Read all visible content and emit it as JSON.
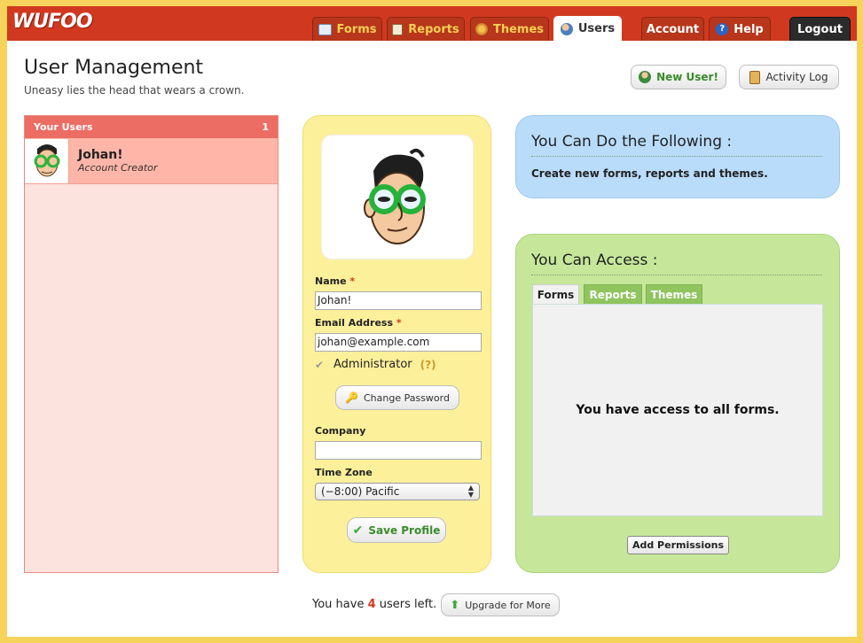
{
  "brand": {
    "logo": "WUFOO",
    "accent": "#d0391f",
    "tab_text_color": "#f6cf53"
  },
  "nav": {
    "tabs": [
      {
        "label": "Forms",
        "icon": "forms-icon"
      },
      {
        "label": "Reports",
        "icon": "reports-icon"
      },
      {
        "label": "Themes",
        "icon": "themes-icon"
      },
      {
        "label": "Users",
        "icon": "users-icon",
        "active": true
      }
    ],
    "account": "Account",
    "help": "Help",
    "logout": "Logout"
  },
  "header": {
    "title": "User Management",
    "subtitle": "Uneasy lies the head that wears a crown.",
    "new_user_label": "New User!",
    "activity_log_label": "Activity Log"
  },
  "users": {
    "heading": "Your Users",
    "count": "1",
    "items": [
      {
        "name": "Johan!",
        "role": "Account Creator"
      }
    ]
  },
  "profile": {
    "name_label": "Name",
    "name_value": "Johan!",
    "email_label": "Email Address",
    "email_value": "johan@example.com",
    "required_mark": "*",
    "admin_label": "Administrator",
    "admin_help": "(?)",
    "admin_checked": true,
    "change_password_label": "Change Password",
    "company_label": "Company",
    "company_value": "",
    "timezone_label": "Time Zone",
    "timezone_value": "(−8:00) Pacific",
    "save_label": "Save Profile"
  },
  "permissions": {
    "can_do_title": "You Can Do the Following :",
    "can_do_text": "Create new forms, reports and themes.",
    "access_title": "You Can Access :",
    "access_tabs": [
      "Forms",
      "Reports",
      "Themes"
    ],
    "access_message": "You have access to all forms.",
    "add_permissions_label": "Add Permissions"
  },
  "footer": {
    "prefix": "You have",
    "users_left": "4",
    "suffix": "users left.",
    "upgrade_label": "Upgrade for More"
  }
}
